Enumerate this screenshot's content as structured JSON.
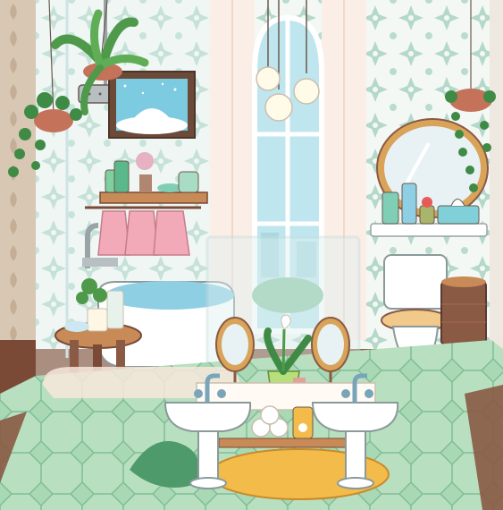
{
  "scene": {
    "palette": {
      "wall_tile": "#f4f8f5",
      "tile_motif": "#9fcdbb",
      "floor_green": "#a9d8b4",
      "floor_grid": "#7fbd97",
      "wood_dark": "#7a4a36",
      "wood_light": "#c88a57",
      "gold_frame": "#d9a35a",
      "tub_water": "#8fcfe3",
      "towel_pink": "#f2aab8",
      "plant_green": "#4f9a4a",
      "rug_yellow": "#f2bb4a",
      "window_sky": "#bfe6ee",
      "porcelain": "#ffffff",
      "outline": "#6a5a4e"
    },
    "objects": [
      {
        "name": "hanging-fern-plant",
        "icon": "fern-icon"
      },
      {
        "name": "hanging-ivy-plant-left",
        "icon": "ivy-icon"
      },
      {
        "name": "hanging-ivy-plant-right",
        "icon": "ivy-icon"
      },
      {
        "name": "shower-head",
        "icon": "shower-icon"
      },
      {
        "name": "framed-snow-painting",
        "icon": "picture-icon"
      },
      {
        "name": "pendant-lights",
        "icon": "bulb-icon"
      },
      {
        "name": "arched-window",
        "icon": "window-icon"
      },
      {
        "name": "round-wall-mirror",
        "icon": "mirror-icon"
      },
      {
        "name": "toilet",
        "icon": "toilet-icon"
      },
      {
        "name": "wicker-basket",
        "icon": "basket-icon"
      },
      {
        "name": "bathtub",
        "icon": "bathtub-icon"
      },
      {
        "name": "wooden-stool",
        "icon": "stool-icon"
      },
      {
        "name": "towel-shelf",
        "icon": "shelf-icon"
      },
      {
        "name": "pink-bathrobes",
        "icon": "robe-icon"
      },
      {
        "name": "double-vanity-sinks",
        "icon": "sink-icon"
      },
      {
        "name": "standing-mirrors",
        "icon": "mirror-icon"
      },
      {
        "name": "calla-lily-plant",
        "icon": "lily-icon"
      },
      {
        "name": "rolled-towels",
        "icon": "towel-icon"
      },
      {
        "name": "yellow-bath-rug",
        "icon": "rug-icon"
      },
      {
        "name": "glass-shower-partition",
        "icon": "glass-icon"
      }
    ]
  }
}
